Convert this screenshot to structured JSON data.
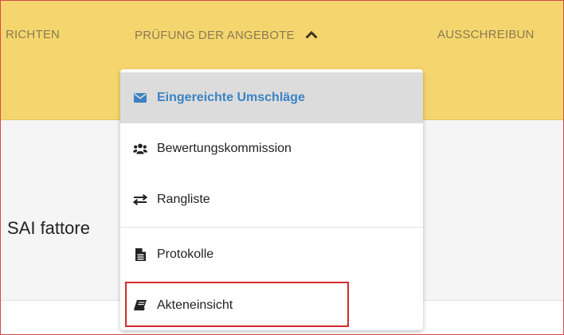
{
  "nav": {
    "item_left": "RICHTEN",
    "item_active": "PRÜFUNG DER ANGEBOTE",
    "item_right": "AUSSCHREIBUN"
  },
  "main": {
    "title": "SAI fattore"
  },
  "dropdown": {
    "items": [
      {
        "label": "Eingereichte Umschläge",
        "icon": "envelope-icon",
        "active": true
      },
      {
        "label": "Bewertungskommission",
        "icon": "users-icon",
        "active": false
      },
      {
        "label": "Rangliste",
        "icon": "exchange-icon",
        "active": false
      },
      {
        "label": "Protokolle",
        "icon": "file-icon",
        "active": false
      },
      {
        "label": "Akteneinsicht",
        "icon": "book-icon",
        "active": false
      }
    ]
  },
  "colors": {
    "topbar": "#f5d66e",
    "active_text": "#3b82c4",
    "highlight_border": "#d42a2a"
  }
}
